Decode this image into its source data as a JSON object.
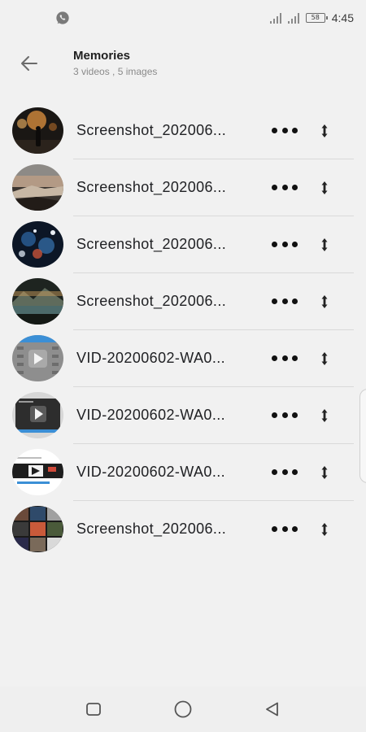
{
  "status_bar": {
    "time": "4:45",
    "battery_level": "58",
    "notification_icon": "whatsapp-icon"
  },
  "header": {
    "title": "Memories",
    "subtitle": "3 videos , 5 images",
    "back_icon": "arrow-left-icon"
  },
  "items": [
    {
      "name": "Screenshot_202006...",
      "thumbnail": "person-night-street-photo"
    },
    {
      "name": "Screenshot_202006...",
      "thumbnail": "shoreline-sunset-photo"
    },
    {
      "name": "Screenshot_202006...",
      "thumbnail": "night-city-lights-photo"
    },
    {
      "name": "Screenshot_202006...",
      "thumbnail": "lake-mountains-photo"
    },
    {
      "name": "VID-20200602-WA0...",
      "thumbnail": "video-play-thumbnail"
    },
    {
      "name": "VID-20200602-WA0...",
      "thumbnail": "video-play-thumbnail"
    },
    {
      "name": "VID-20200602-WA0...",
      "thumbnail": "video-play-thumbnail"
    },
    {
      "name": "Screenshot_202006...",
      "thumbnail": "photo-grid-collage"
    }
  ],
  "row_actions": {
    "more_icon": "more-horizontal-icon",
    "drag_icon": "drag-handle-icon"
  },
  "nav_bar": {
    "recents_icon": "square-icon",
    "home_icon": "circle-icon",
    "back_icon": "triangle-back-icon"
  }
}
